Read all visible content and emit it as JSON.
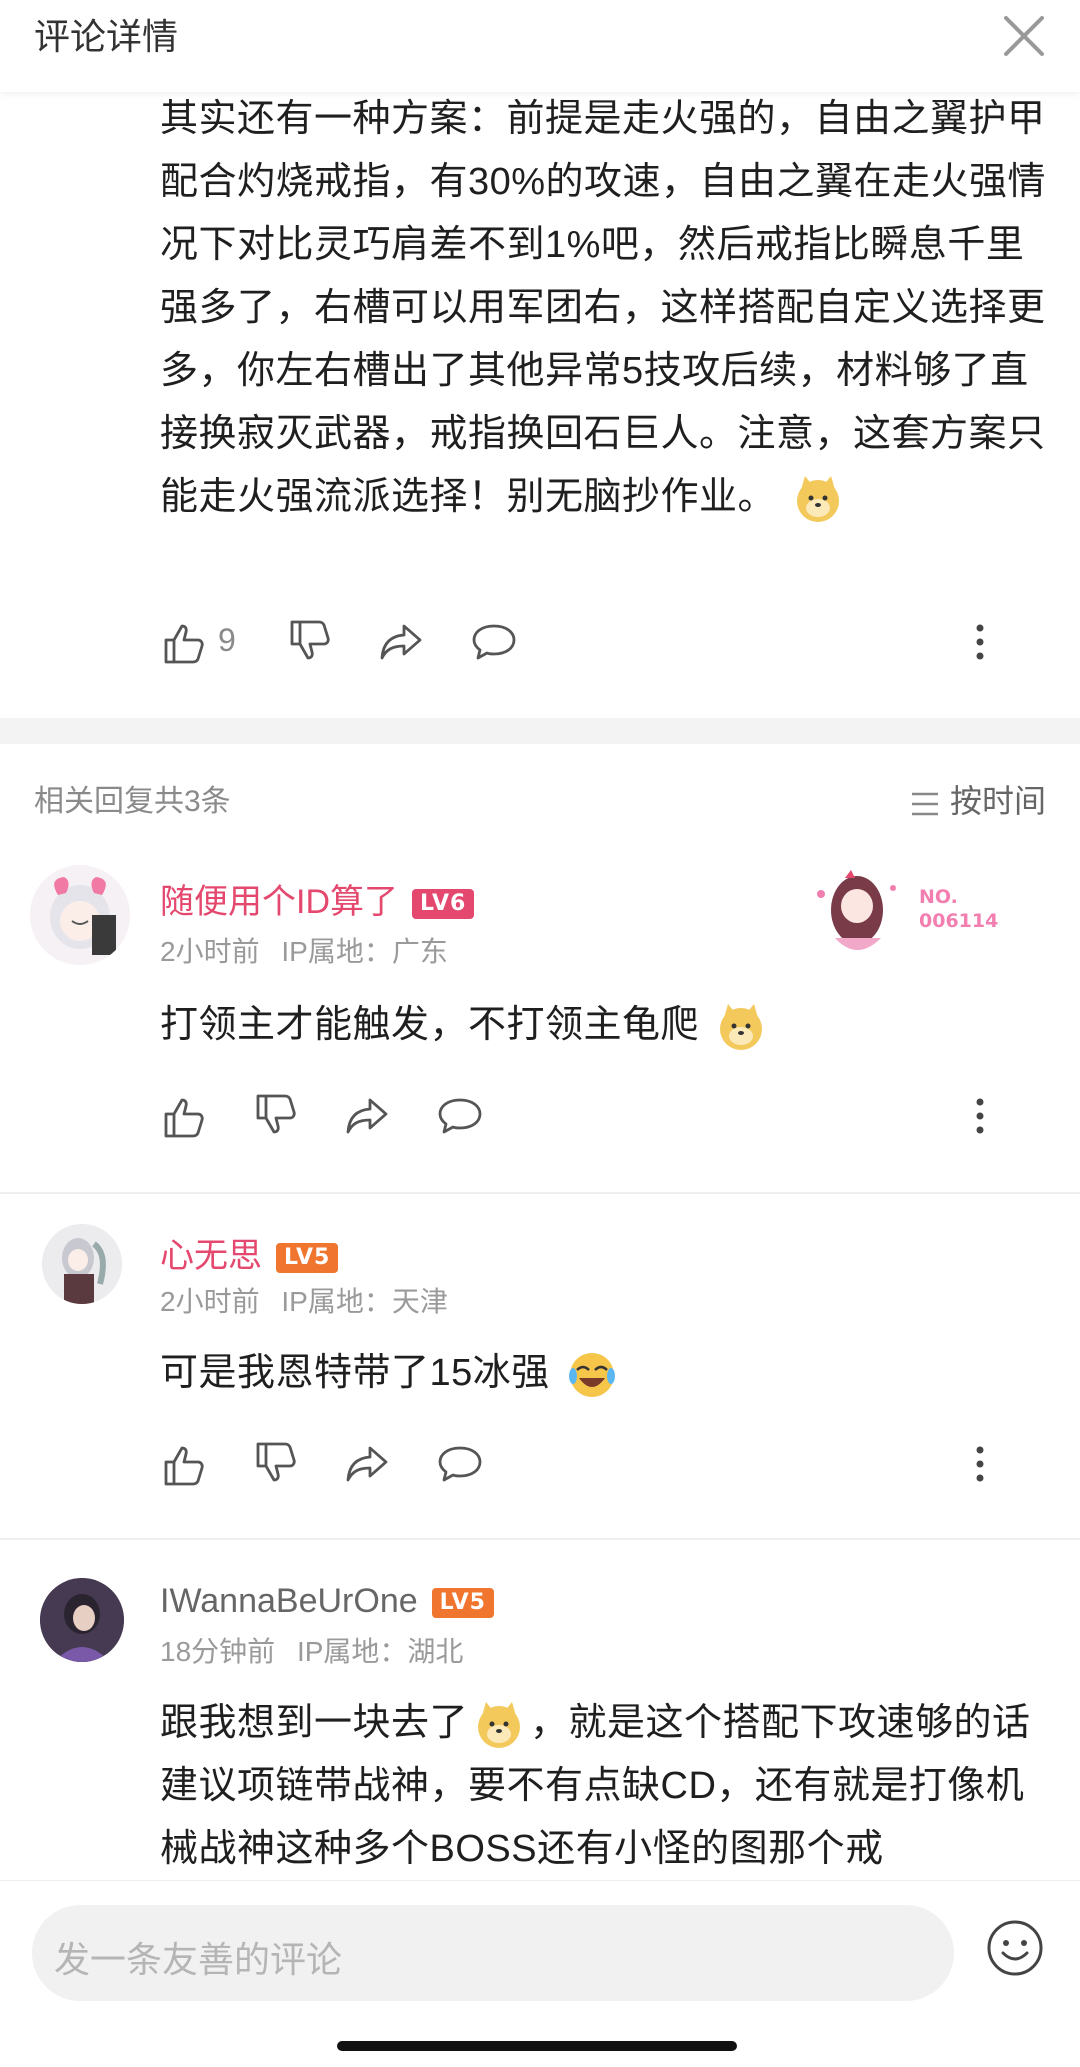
{
  "header": {
    "title": "评论详情"
  },
  "main_comment": {
    "text": "其实还有一种方案：前提是走火强的，自由之翼护甲配合灼烧戒指，有30%的攻速，自由之翼在走火强情况下对比灵巧肩差不到1%吧，然后戒指比瞬息千里强多了，右槽可以用军团右，这样搭配自定义选择更多，你左右槽出了其他异常5技攻后续，材料够了直接换寂灭武器，戒指换回石巨人。注意，这套方案只能走火强流派选择！别无脑抄作业。",
    "like_count": "9"
  },
  "replies_header": {
    "count_label": "相关回复共3条",
    "sort_label": "按时间"
  },
  "replies": [
    {
      "username": "随便用个ID算了",
      "level": "LV6",
      "level_color": "#e5486e",
      "name_color": "#e5486e",
      "time": "2小时前",
      "ip": "IP属地：广东",
      "text": "打领主才能触发，不打领主龟爬",
      "badge_text": "NO.",
      "badge_number": "006114"
    },
    {
      "username": "心无思",
      "level": "LV5",
      "level_color": "#f0752f",
      "name_color": "#e5486e",
      "time": "2小时前",
      "ip": "IP属地：天津",
      "text": "可是我恩特带了15冰强"
    },
    {
      "username": "IWannaBeUrOne",
      "level": "LV5",
      "level_color": "#f0752f",
      "name_color": "#666666",
      "time": "18分钟前",
      "ip": "IP属地：湖北",
      "text_before_emoji": "跟我想到一块去了",
      "text_after_emoji": "，就是这个搭配下攻速够的话建议项链带战神，要不有点缺CD，还有就是打像机械战神这种多个BOSS还有小怪的图那个戒"
    }
  ],
  "input": {
    "placeholder": "发一条友善的评论"
  }
}
